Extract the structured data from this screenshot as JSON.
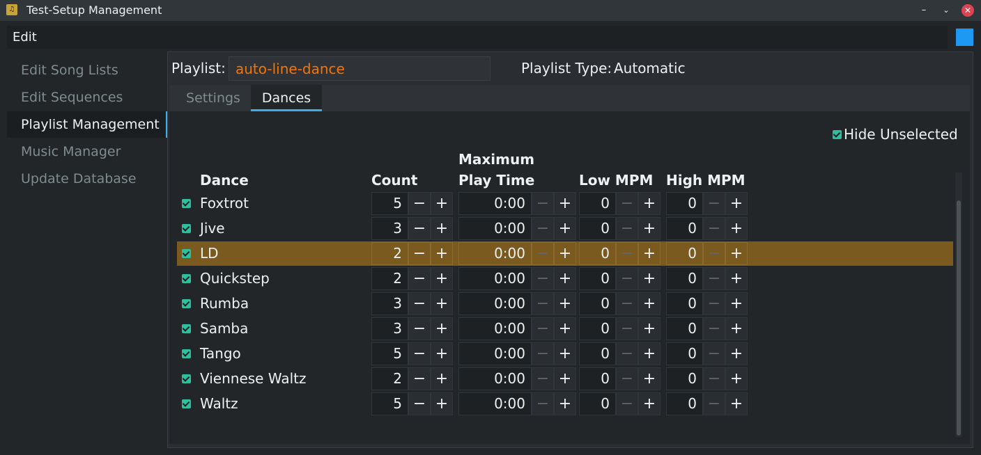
{
  "window": {
    "title": "Test-Setup Management",
    "minimize": "–",
    "maximize": "⌄",
    "close": "✕"
  },
  "menu": {
    "edit": "Edit"
  },
  "sidebar": {
    "items": [
      {
        "label": "Edit Song Lists"
      },
      {
        "label": "Edit Sequences"
      },
      {
        "label": "Playlist Management"
      },
      {
        "label": "Music Manager"
      },
      {
        "label": "Update Database"
      }
    ],
    "active": "Playlist Management"
  },
  "playlist": {
    "label": "Playlist:",
    "name": "auto-line-dance",
    "type_label": "Playlist Type:",
    "type_value": "Automatic"
  },
  "tabs": {
    "settings": "Settings",
    "dances": "Dances",
    "active": "Dances"
  },
  "dances_panel": {
    "hide_unselected": {
      "label": "Hide Unselected",
      "checked": true
    },
    "headers": {
      "dance": "Dance",
      "count": "Count",
      "max_line1": "Maximum",
      "max_line2": "Play Time",
      "low_mpm": "Low MPM",
      "high_mpm": "High MPM"
    },
    "minus": "−",
    "plus": "+",
    "rows": [
      {
        "name": "Foxtrot",
        "checked": true,
        "count": "5",
        "max_time": "0:00",
        "low": "0",
        "high": "0"
      },
      {
        "name": "Jive",
        "checked": true,
        "count": "3",
        "max_time": "0:00",
        "low": "0",
        "high": "0"
      },
      {
        "name": "LD",
        "checked": true,
        "count": "2",
        "max_time": "0:00",
        "low": "0",
        "high": "0",
        "selected": true
      },
      {
        "name": "Quickstep",
        "checked": true,
        "count": "2",
        "max_time": "0:00",
        "low": "0",
        "high": "0"
      },
      {
        "name": "Rumba",
        "checked": true,
        "count": "3",
        "max_time": "0:00",
        "low": "0",
        "high": "0"
      },
      {
        "name": "Samba",
        "checked": true,
        "count": "3",
        "max_time": "0:00",
        "low": "0",
        "high": "0"
      },
      {
        "name": "Tango",
        "checked": true,
        "count": "5",
        "max_time": "0:00",
        "low": "0",
        "high": "0"
      },
      {
        "name": "Viennese Waltz",
        "checked": true,
        "count": "2",
        "max_time": "0:00",
        "low": "0",
        "high": "0"
      },
      {
        "name": "Waltz",
        "checked": true,
        "count": "5",
        "max_time": "0:00",
        "low": "0",
        "high": "0"
      }
    ]
  },
  "colors": {
    "accent": "#3daee9",
    "selection": "#7a5a1e",
    "playlist_name": "#f67400",
    "checkbox": "#2dbf9e",
    "blue_square": "#1d99f3"
  }
}
